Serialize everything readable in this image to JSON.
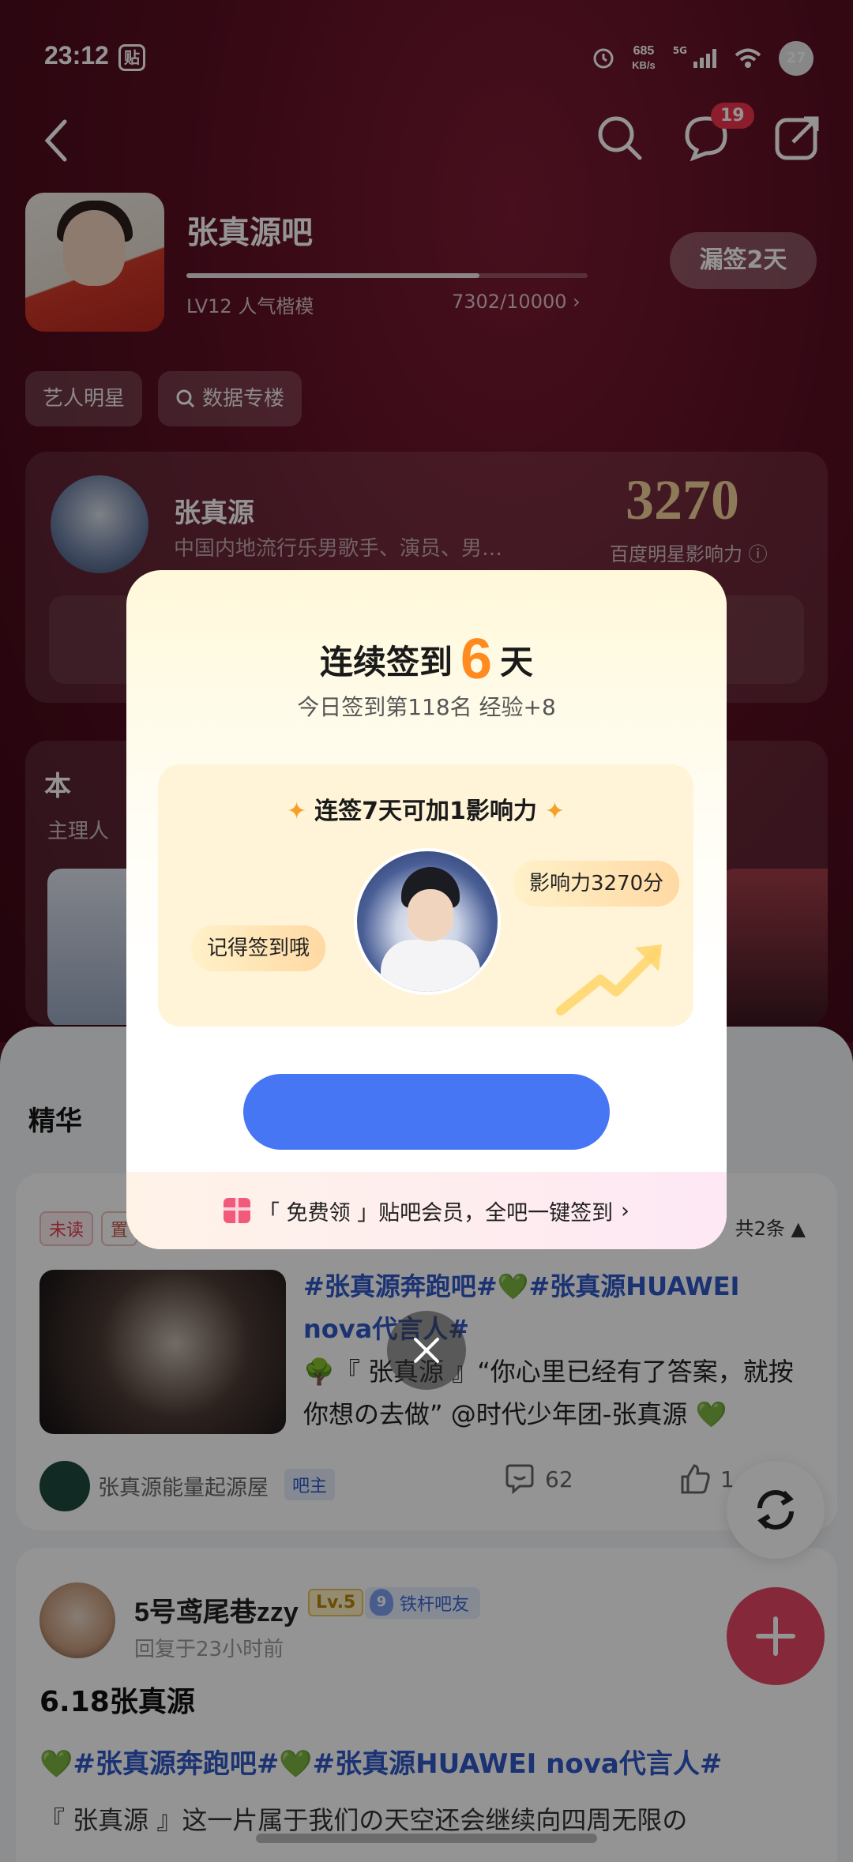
{
  "status_bar": {
    "time": "23:12",
    "notif_label": "贴",
    "speed_value": "685",
    "speed_unit": "KB/s",
    "network": "5G",
    "battery": "27"
  },
  "nav": {
    "message_badge": "19"
  },
  "forum": {
    "title": "张真源吧",
    "level": "LV12 人气楷模",
    "exp": "7302/10000",
    "exp_progress": 0.7302,
    "sign_button": "漏签2天"
  },
  "chips": [
    {
      "label": "艺人明星"
    },
    {
      "label": "数据专楼"
    }
  ],
  "star_card": {
    "name": "张真源",
    "desc": "中国内地流行乐男歌手、演员、男…",
    "score": "3270",
    "score_label": "百度明星影响力"
  },
  "week_card": {
    "title": "本",
    "sub": "主理人"
  },
  "feed": {
    "tab": "精华",
    "post1": {
      "tag_unread": "未读",
      "tag_pin": "置",
      "count": "共2条",
      "hashtags": "#张真源奔跑吧#💚#张真源HUAWEI nova代言人#",
      "text": "🌳『 张真源 』“你心里已经有了答案，就按你想の去做” @时代少年团-张真源 💚",
      "author": "张真源能量起源屋",
      "owner_badge": "吧主",
      "comments": "62",
      "likes": "1"
    },
    "post2": {
      "name": "5号鸢尾巷zzy",
      "level": "Lv.5",
      "badge_num": "9",
      "badge": "铁杆吧友",
      "time": "回复于23小时前",
      "title": "6.18张真源",
      "tags": "💚#张真源奔跑吧#💚#张真源HUAWEI nova代言人#",
      "body": "『 张真源 』这一片属于我们の天空还会继续向四周无限の"
    }
  },
  "modal": {
    "title_prefix": "连续签到",
    "days": "6",
    "title_suffix": "天",
    "subtitle": "今日签到第118名 经验+8",
    "panel_title": "连签7天可加1影响力",
    "bubble_left": "记得签到哦",
    "bubble_right": "影响力3270分",
    "button_label": "",
    "footer": "「 免费领 」贴吧会员，全吧一键签到"
  },
  "colors": {
    "accent_orange": "#ff8a1f",
    "button_blue": "#4776f5",
    "hashtag_blue": "#2f56c7",
    "fab_red": "#e64662"
  }
}
